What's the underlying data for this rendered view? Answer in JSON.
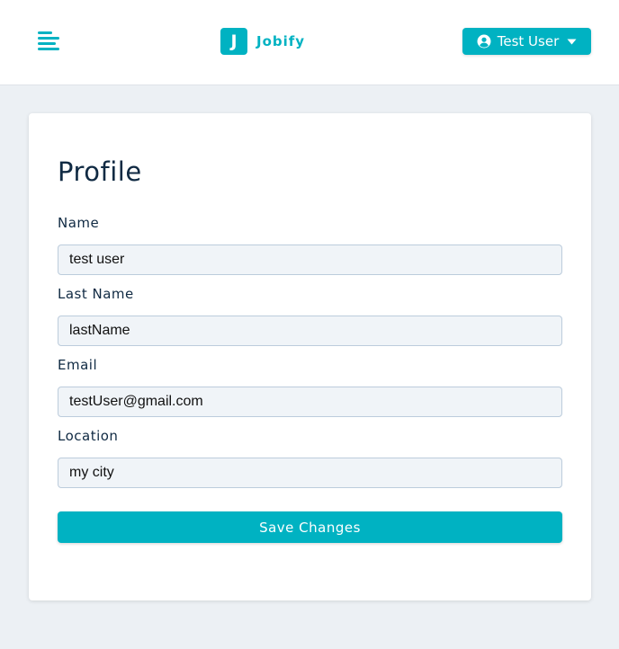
{
  "navbar": {
    "menu_icon": "menu-icon",
    "logo_letter": "J",
    "logo_text": "Jobify",
    "user_button": {
      "icon": "user-circle-icon",
      "label": "Test User",
      "caret_icon": "caret-down-icon"
    }
  },
  "profile": {
    "title": "Profile",
    "fields": [
      {
        "label": "Name",
        "value": "test user"
      },
      {
        "label": "Last Name",
        "value": "lastName"
      },
      {
        "label": "Email",
        "value": "testUser@gmail.com"
      },
      {
        "label": "Location",
        "value": "my city"
      }
    ],
    "submit_label": "Save Changes"
  },
  "colors": {
    "primary": "#00b2c2",
    "page_background": "#ecf0f4",
    "heading_text": "#102a43",
    "input_background": "#f0f4f8",
    "input_border": "#bcccdc"
  }
}
